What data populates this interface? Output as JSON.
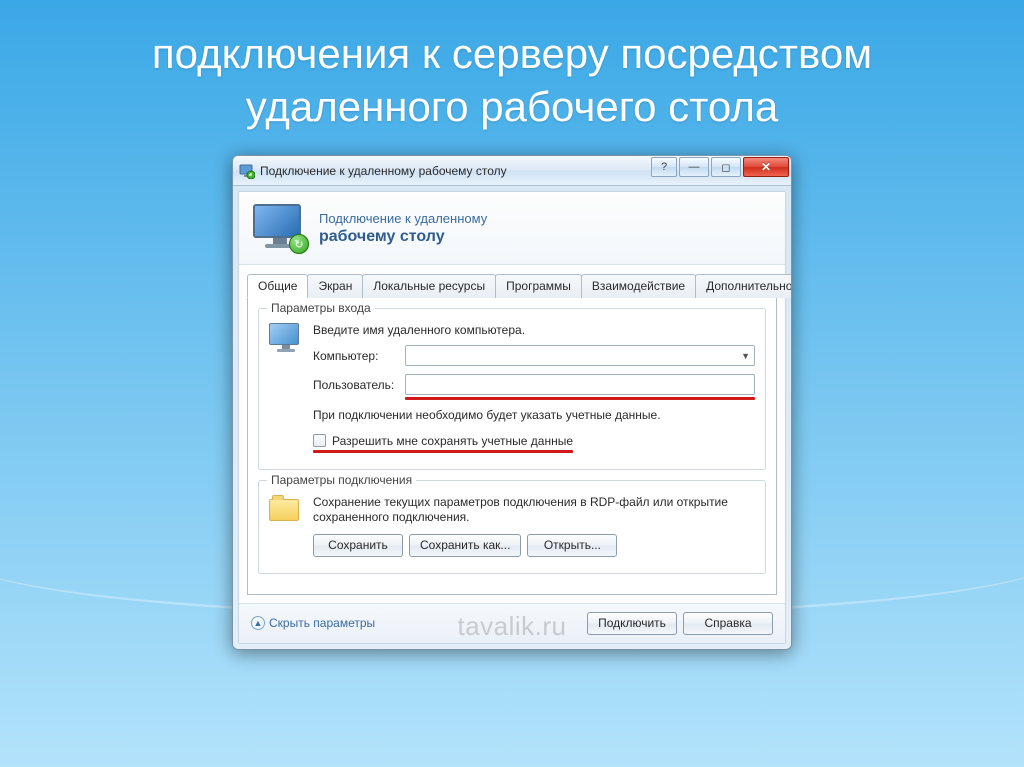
{
  "slide": {
    "title": "подключения к серверу посредством удаленного рабочего стола"
  },
  "window": {
    "title": "Подключение к удаленному рабочему столу",
    "header_line1": "Подключение к удаленному",
    "header_line2": "рабочему столу"
  },
  "tabs": [
    "Общие",
    "Экран",
    "Локальные ресурсы",
    "Программы",
    "Взаимодействие",
    "Дополнительно"
  ],
  "login_group": {
    "legend": "Параметры входа",
    "instruction": "Введите имя удаленного компьютера.",
    "computer_label": "Компьютер:",
    "computer_value": "",
    "user_label": "Пользователь:",
    "user_value": "",
    "note": "При подключении необходимо будет указать учетные данные.",
    "allow_save_label": "Разрешить мне сохранять учетные данные"
  },
  "conn_group": {
    "legend": "Параметры подключения",
    "desc": "Сохранение текущих параметров подключения в RDP-файл или открытие сохраненного подключения.",
    "save": "Сохранить",
    "save_as": "Сохранить как...",
    "open": "Открыть..."
  },
  "bottom": {
    "collapse": "Скрыть параметры",
    "connect": "Подключить",
    "help": "Справка"
  },
  "watermark": "tavalik.ru"
}
